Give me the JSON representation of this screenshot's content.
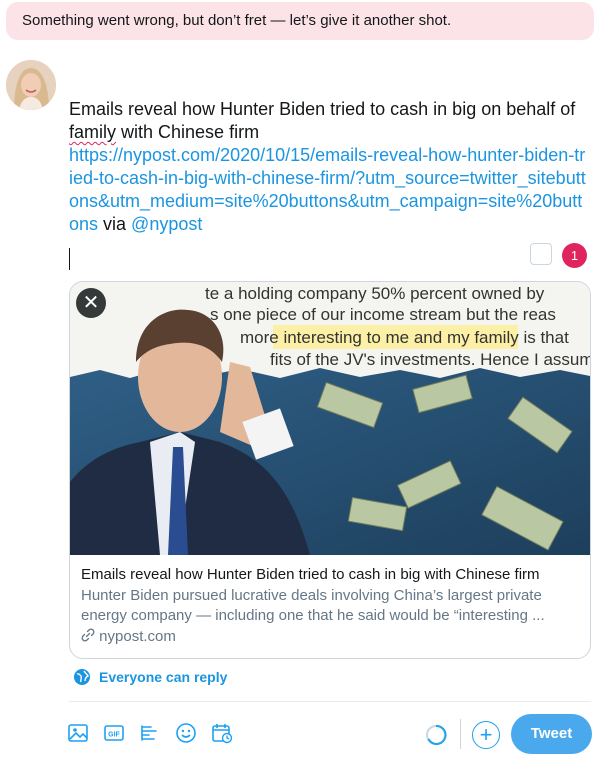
{
  "error_banner": {
    "text": "Something went wrong, but don’t fret — let’s give it another shot."
  },
  "compose": {
    "text_before": "Emails reveal how Hunter Biden tried to cash in big on behalf of ",
    "misspelled_word": "family",
    "text_after": " with Chinese firm",
    "link": "https://nypost.com/2020/10/15/emails-reveal-how-hunter-biden-tried-to-cash-in-big-with-chinese-firm/?utm_source=twitter_sitebuttons&utm_medium=site%20buttons&utm_campaign=site%20buttons",
    "via_text": " via ",
    "mention": "@nypost",
    "char_over_count": "1"
  },
  "card": {
    "image_text_lines": [
      "te a holding company 50% percent owned by",
      "s one piece of our income stream but the reas",
      "more interesting to me and my family is that",
      "fits of the JV's investments.  Hence I assume"
    ],
    "image_highlight": "interesting to me and my family",
    "title": "Emails reveal how Hunter Biden tried to cash in big with Chinese firm",
    "description": "Hunter Biden pursued lucrative deals involving China’s largest private energy company — including one that he said would be “interesting ...",
    "domain": "nypost.com",
    "close_symbol": "✕"
  },
  "reply_setting": {
    "label": "Everyone can reply"
  },
  "toolbar": {
    "icons": [
      "media-icon",
      "gif-icon",
      "poll-icon",
      "emoji-icon",
      "schedule-icon"
    ],
    "gif_label": "GIF",
    "add_symbol": "+",
    "tweet_label": "Tweet"
  },
  "colors": {
    "accent": "#1da1f2",
    "link": "#1b95e0",
    "error_bg": "#fbe3e7",
    "counter_over": "#e0245e",
    "tweet_button": "#4aa9ed"
  }
}
